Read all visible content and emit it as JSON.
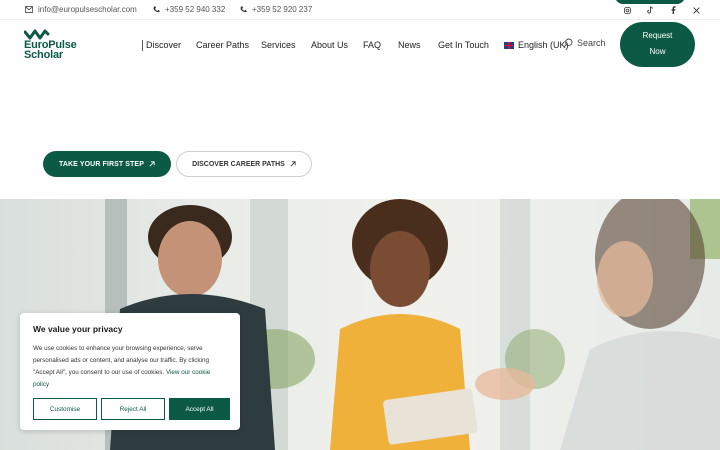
{
  "topbar": {
    "email": "info@europulsescholar.com",
    "phone1": "+359 52 940 332",
    "phone2": "+359 52 920 237",
    "social_icons": [
      "instagram-icon",
      "tiktok-icon",
      "facebook-icon",
      "x-icon"
    ]
  },
  "brand": {
    "name_line1": "EuroPulse",
    "name_line2": "Scholar",
    "color": "#0c5a45"
  },
  "nav": {
    "items": [
      "Discover",
      "Career Paths",
      "Services",
      "About Us",
      "FAQ",
      "News",
      "Get In Touch"
    ]
  },
  "language": {
    "label": "English (UK)"
  },
  "search": {
    "label": "Search"
  },
  "request_button": {
    "line1": "Request",
    "line2": "Now"
  },
  "hero": {
    "cta_primary": "TAKE YOUR FIRST STEP",
    "cta_secondary": "DISCOVER CAREER PATHS"
  },
  "cookie": {
    "title": "We value your privacy",
    "text": "We use cookies to enhance your browsing experience, serve personalised ads or content, and analyse our traffic. By clicking \"Accept All\", you consent to our use of cookies.",
    "link": "View our cookie policy",
    "customise": "Customise",
    "reject": "Reject All",
    "accept": "Accept All"
  }
}
